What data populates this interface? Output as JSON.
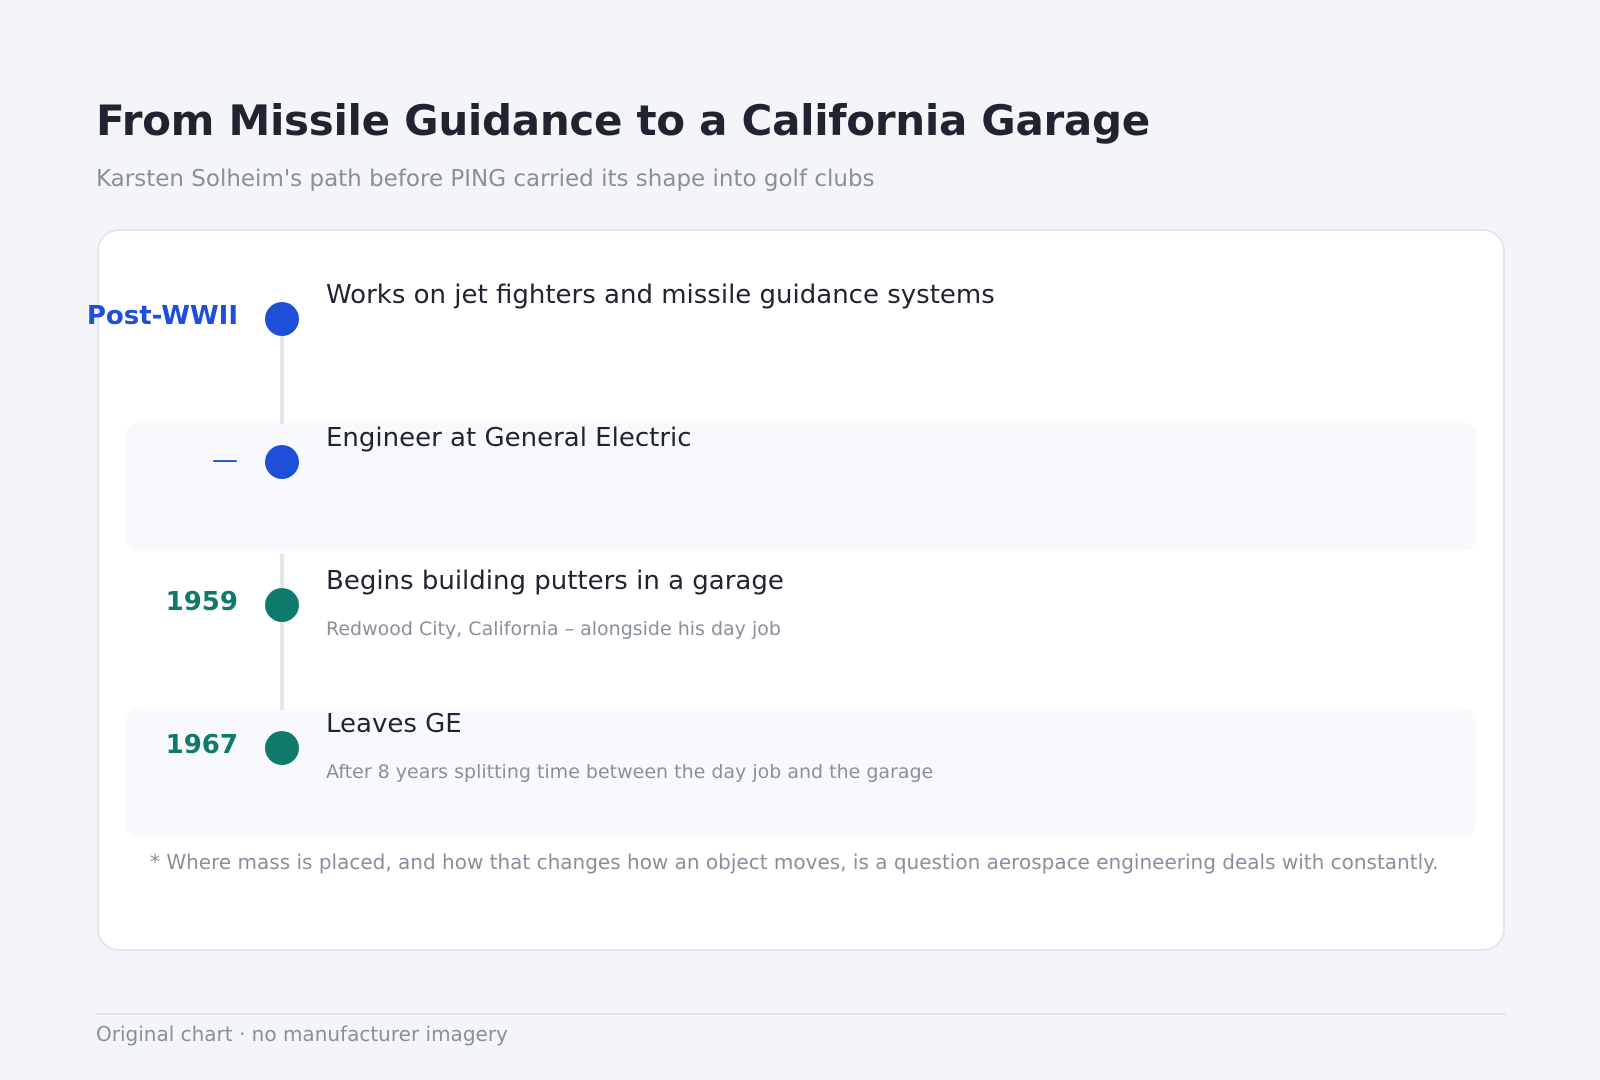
{
  "header": {
    "title": "From Missile Guidance to a California Garage",
    "subtitle": "Karsten Solheim's path before PING carried its shape into golf clubs"
  },
  "colors": {
    "early_accent": "#1e4fd8",
    "later_accent": "#0f7a6c",
    "connector": "#e3e5ec"
  },
  "timeline": [
    {
      "date": "Post-WWII",
      "event": "Works on jet fighters and missile guidance systems",
      "detail": ""
    },
    {
      "date": "—",
      "event": "Engineer at General Electric",
      "detail": ""
    },
    {
      "date": "1959",
      "event": "Begins building putters in a garage",
      "detail": "Redwood City, California – alongside his day job"
    },
    {
      "date": "1967",
      "event": "Leaves GE",
      "detail": "After 8 years splitting time between the day job and the garage"
    }
  ],
  "footnote": "* Where mass is placed, and how that changes how an object moves, is a question aerospace engineering deals with constantly.",
  "credit": "Original chart · no manufacturer imagery"
}
